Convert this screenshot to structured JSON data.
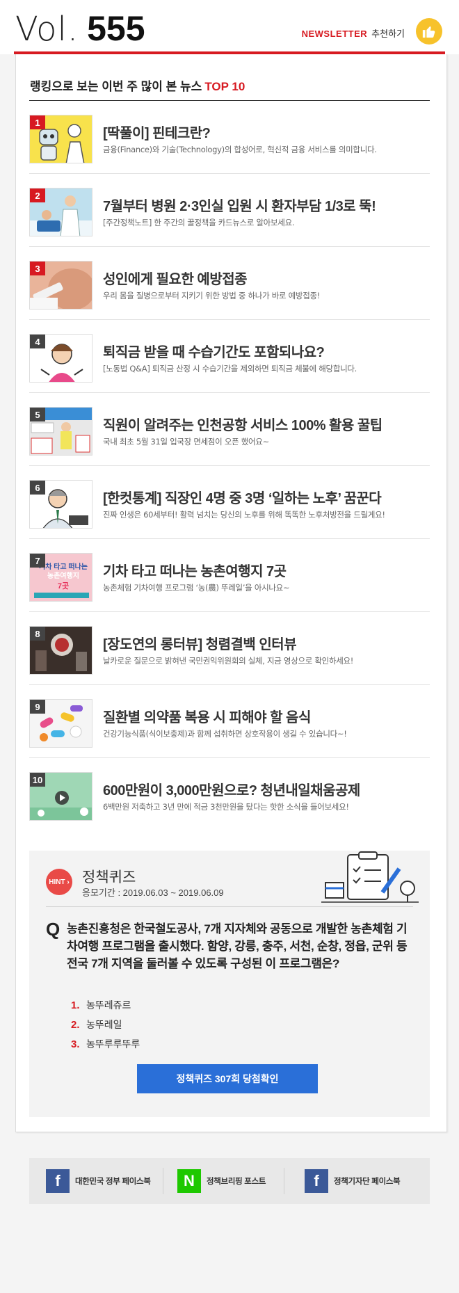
{
  "header": {
    "vol_label": "Vol.",
    "vol_number": "555",
    "newsletter_label": "NEWSLETTER",
    "recommend_label": "추천하기",
    "thumb_icon": "thumbs-up-icon",
    "accent_color": "#d71a21"
  },
  "ranking": {
    "title": "랭킹으로 보는 이번 주 많이 본 뉴스",
    "top_label": "TOP 10",
    "items": [
      {
        "rank": "1",
        "title": "[딱풀이] 핀테크란?",
        "desc": "금융(Finance)와 기술(Technology)의 합성어로, 혁신적 금융 서비스를 의미합니다."
      },
      {
        "rank": "2",
        "title": "7월부터 병원 2·3인실 입원 시 환자부담 1/3로 뚝!",
        "desc": "[주간정책노트] 한 주간의 꿀정책을 카드뉴스로 알아보세요."
      },
      {
        "rank": "3",
        "title": "성인에게 필요한 예방접종",
        "desc": "우리 몸을 질병으로부터 지키기 위한 방법 중 하나가 바로 예방접종!"
      },
      {
        "rank": "4",
        "title": "퇴직금 받을 때 수습기간도 포함되나요?",
        "desc": "[노동법 Q&A] 퇴직금 산정 시 수습기간을 제외하면 퇴직금 체불에 해당합니다."
      },
      {
        "rank": "5",
        "title": "직원이 알려주는 인천공항 서비스 100% 활용 꿀팁",
        "desc": "국내 최초 5월 31일 입국장 면세점이 오픈 했어요~"
      },
      {
        "rank": "6",
        "title": "[한컷통계] 직장인 4명 중 3명 ‘일하는 노후’ 꿈꾼다",
        "desc": "진짜 인생은 60세부터! 활력 넘치는 당신의 노후를 위해 똑똑한 노후처방전을 드릴게요!"
      },
      {
        "rank": "7",
        "title": "기차 타고 떠나는 농촌여행지 7곳",
        "desc": "농촌체험 기차여행 프로그램 ‘농(農) 뚜레일’을 아시나요~",
        "thumb_text_1": "기차 타고 떠나는",
        "thumb_text_2": "농촌여행지",
        "thumb_text_3": "7곳"
      },
      {
        "rank": "8",
        "title": "[장도연의 롱터뷰] 청렴결백 인터뷰",
        "desc": "날카로운 질문으로 밝혀낸 국민권익위원회의 실체, 지금 영상으로 확인하세요!"
      },
      {
        "rank": "9",
        "title": "질환별 의약품 복용 시 피해야 할 음식",
        "desc": "건강기능식품(식이보충제)과 함께 섭취하면 상호작용이 생길 수 있습니다~!"
      },
      {
        "rank": "10",
        "title": "600만원이 3,000만원으로? 청년내일채움공제",
        "desc": "6백만원 저축하고 3년 만에 적금 3천만원을 탔다는 핫한 소식을 들어보세요!"
      }
    ]
  },
  "quiz": {
    "hint_label": "HINT ›",
    "title": "정책퀴즈",
    "period": "응모기간 : 2019.06.03 ~ 2019.06.09",
    "q_mark": "Q",
    "question": "농촌진흥청은 한국철도공사, 7개 지자체와 공동으로 개발한 농촌체험 기차여행 프로그램을 출시했다. 함양, 강릉, 충주, 서천, 순창, 정읍, 군위 등 전국 7개 지역을 둘러볼 수 있도록 구성된 이 프로그램은?",
    "options": [
      {
        "num": "1.",
        "label": "농뚜레쥬르"
      },
      {
        "num": "2.",
        "label": "농뚜레일"
      },
      {
        "num": "3.",
        "label": "농뚜루루뚜루"
      }
    ],
    "button_label": "정책퀴즈 307회 당첨확인"
  },
  "footer": {
    "links": [
      {
        "icon": "facebook-icon",
        "glyph": "f",
        "label": "대한민국 정부 페이스북"
      },
      {
        "icon": "naver-post-icon",
        "glyph": "N",
        "label": "정책브리핑 포스트"
      },
      {
        "icon": "facebook-icon",
        "glyph": "f",
        "label": "정책기자단 페이스북"
      }
    ]
  }
}
